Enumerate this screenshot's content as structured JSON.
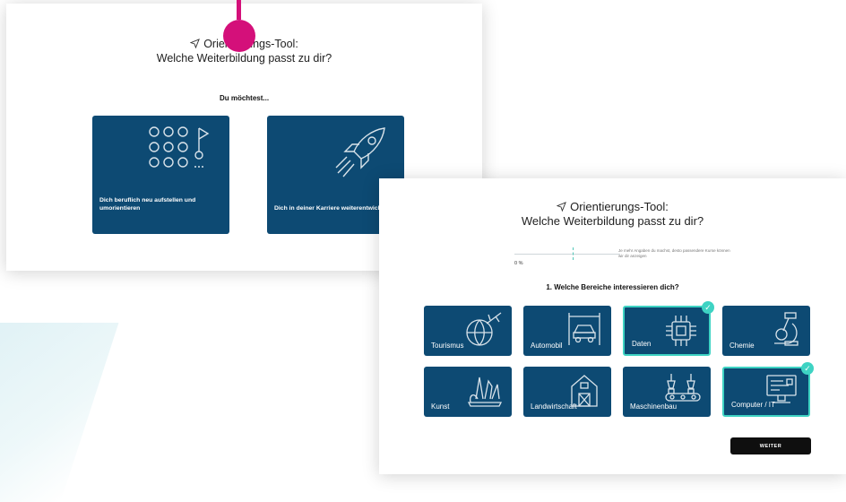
{
  "card1": {
    "title_prefix": "Orientierungs-Tool:",
    "title_line2": "Welche Weiterbildung passt zu dir?",
    "subtitle": "Du möchtest...",
    "options": [
      {
        "label": "Dich beruflich neu aufstellen und umorientieren",
        "icon": "pattern-grid-icon"
      },
      {
        "label": "Dich in deiner Karriere weiterentwickeln",
        "icon": "rocket-icon"
      }
    ]
  },
  "card2": {
    "title_line1": "Orientierungs-Tool:",
    "title_line2": "Welche Weiterbildung passt zu dir?",
    "progress": {
      "value_percent": 0,
      "label": "0 %",
      "hint": "Je mehr Angaben du machst, desto passendere Kurse können wir dir anzeigen"
    },
    "question": "1. Welche Bereiche interessieren dich?",
    "tiles": [
      {
        "label": "Tourismus",
        "icon": "globe-plane-icon",
        "selected": false
      },
      {
        "label": "Automobil",
        "icon": "car-lift-icon",
        "selected": false
      },
      {
        "label": "Daten",
        "icon": "chip-icon",
        "selected": true
      },
      {
        "label": "Chemie",
        "icon": "microscope-icon",
        "selected": false
      },
      {
        "label": "Kunst",
        "icon": "art-supplies-icon",
        "selected": false
      },
      {
        "label": "Landwirtschaft",
        "icon": "farmhouse-icon",
        "selected": false
      },
      {
        "label": "Maschinenbau",
        "icon": "robot-arm-icon",
        "selected": false
      },
      {
        "label": "Computer / IT",
        "icon": "computer-screen-icon",
        "selected": true
      }
    ],
    "next_button": "WEITER"
  },
  "colors": {
    "tile": "#0d4a73",
    "accent": "#3ed3c3",
    "marker": "#d4107a"
  }
}
